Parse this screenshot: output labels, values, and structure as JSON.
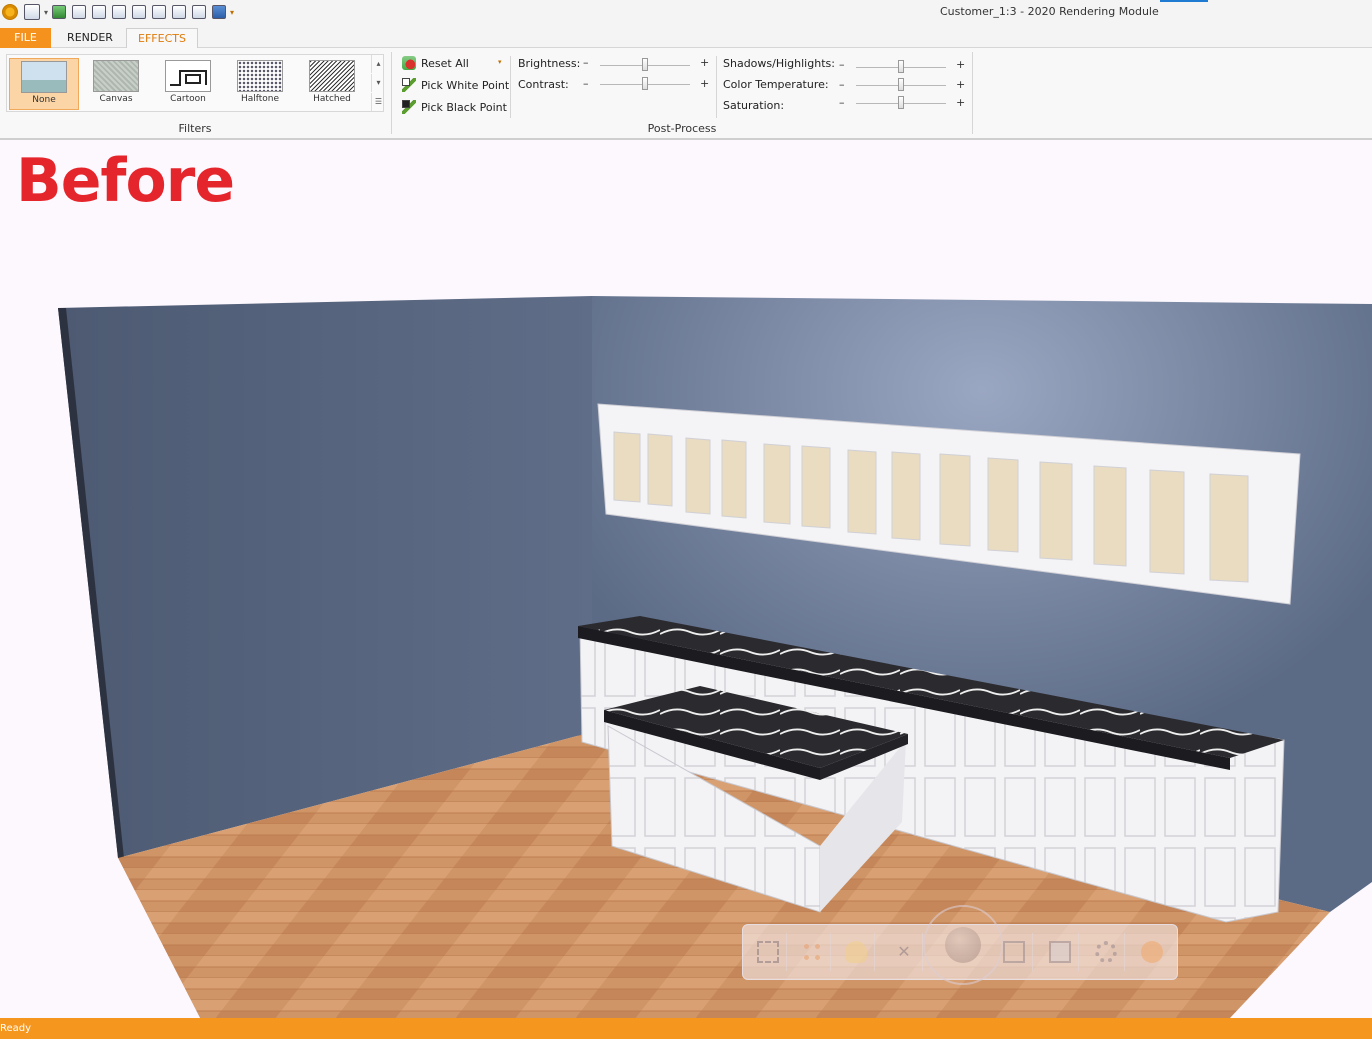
{
  "window": {
    "title": "Customer_1:3 - 2020 Rendering Module"
  },
  "quick_access": {
    "icons": [
      "app-icon",
      "save-icon",
      "export-icon",
      "print-icon",
      "print-preview-icon",
      "page-setup-icon",
      "new-page-icon",
      "layout-icon",
      "compare-icon",
      "camera-icon",
      "help-icon",
      "customize-arrow-icon"
    ]
  },
  "tabs": [
    {
      "label": "FILE"
    },
    {
      "label": "RENDER"
    },
    {
      "label": "EFFECTS"
    }
  ],
  "ribbon": {
    "filters": {
      "group_label": "Filters",
      "items": [
        {
          "label": "None",
          "selected": true
        },
        {
          "label": "Canvas",
          "selected": false
        },
        {
          "label": "Cartoon",
          "selected": false
        },
        {
          "label": "Halftone",
          "selected": false
        },
        {
          "label": "Hatched",
          "selected": false
        }
      ]
    },
    "post_process": {
      "group_label": "Post-Process",
      "buttons": [
        {
          "label": "Reset All"
        },
        {
          "label": "Pick White Point"
        },
        {
          "label": "Pick Black Point"
        }
      ],
      "sliders": [
        {
          "label": "Brightness:",
          "minus": "–",
          "plus": "+",
          "value": 0.5
        },
        {
          "label": "Contrast:",
          "minus": "–",
          "plus": "+",
          "value": 0.5
        },
        {
          "label": "Shadows/Highlights:",
          "minus": "–",
          "plus": "+",
          "value": 0.5
        },
        {
          "label": "Color Temperature:",
          "minus": "–",
          "plus": "+",
          "value": 0.5
        },
        {
          "label": "Saturation:",
          "minus": "–",
          "plus": "+",
          "value": 0.5
        }
      ]
    }
  },
  "viewport": {
    "overlay_text": "Before",
    "colors": {
      "wall": "#5b6a85",
      "floor": "#c98c5e",
      "cabinet": "#f4f4f6",
      "countertop": "#2b2b2f",
      "overlay": "#e5252c"
    }
  },
  "nav_toolbar": {
    "icons": [
      "zoom-extents-icon",
      "material-palette-icon",
      "light-bulb-icon",
      "cross-icon",
      "orbit-icon",
      "fit-view-icon",
      "screen-copy-icon",
      "settings-gear-icon",
      "camera-icon"
    ]
  },
  "status": {
    "text": "Ready",
    "color": "#f5961f"
  }
}
